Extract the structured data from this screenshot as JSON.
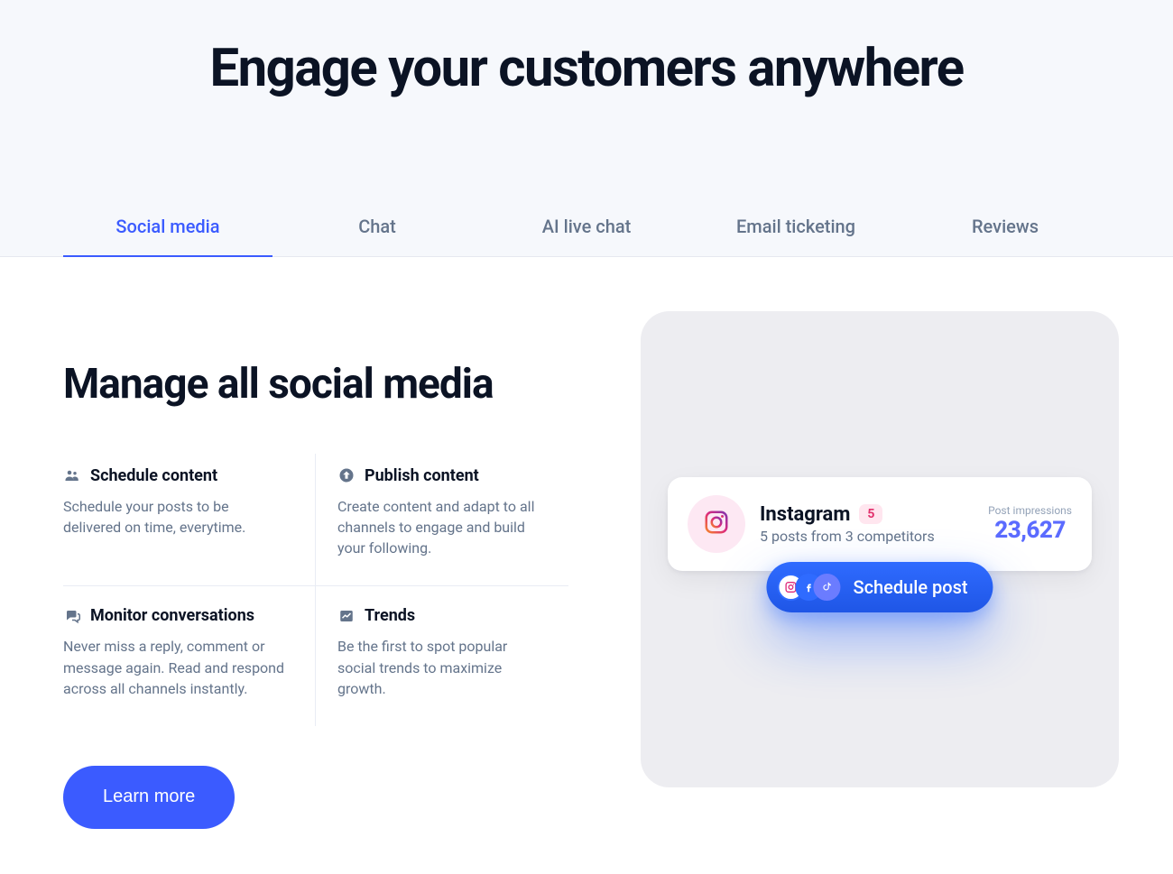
{
  "hero": {
    "title": "Engage your customers anywhere"
  },
  "tabs": [
    {
      "label": "Social media",
      "active": true
    },
    {
      "label": "Chat",
      "active": false
    },
    {
      "label": "AI live chat",
      "active": false
    },
    {
      "label": "Email ticketing",
      "active": false
    },
    {
      "label": "Reviews",
      "active": false
    }
  ],
  "section": {
    "title": "Manage all social media"
  },
  "features": [
    {
      "icon": "people-icon",
      "title": "Schedule content",
      "desc": "Schedule your posts to be delivered on time, everytime."
    },
    {
      "icon": "arrow-up-circle-icon",
      "title": "Publish content",
      "desc": "Create content and adapt to all channels to engage and build your following."
    },
    {
      "icon": "chat-bubbles-icon",
      "title": "Monitor conversations",
      "desc": "Never miss a reply, comment or message again. Read and respond across all channels instantly."
    },
    {
      "icon": "chart-trend-icon",
      "title": "Trends",
      "desc": "Be the first to spot popular social trends to maximize growth."
    }
  ],
  "cta": {
    "label": "Learn more"
  },
  "widget": {
    "channel": "Instagram",
    "badge": "5",
    "subtitle": "5 posts from 3 competitors",
    "impressions_label": "Post impressions",
    "impressions_value": "23,627",
    "pill_label": "Schedule post",
    "pill_icons": [
      "instagram-icon",
      "facebook-icon",
      "tiktok-icon"
    ]
  },
  "colors": {
    "accent": "#3b5bff",
    "panel": "#ededf1",
    "text_muted": "#64748b"
  }
}
